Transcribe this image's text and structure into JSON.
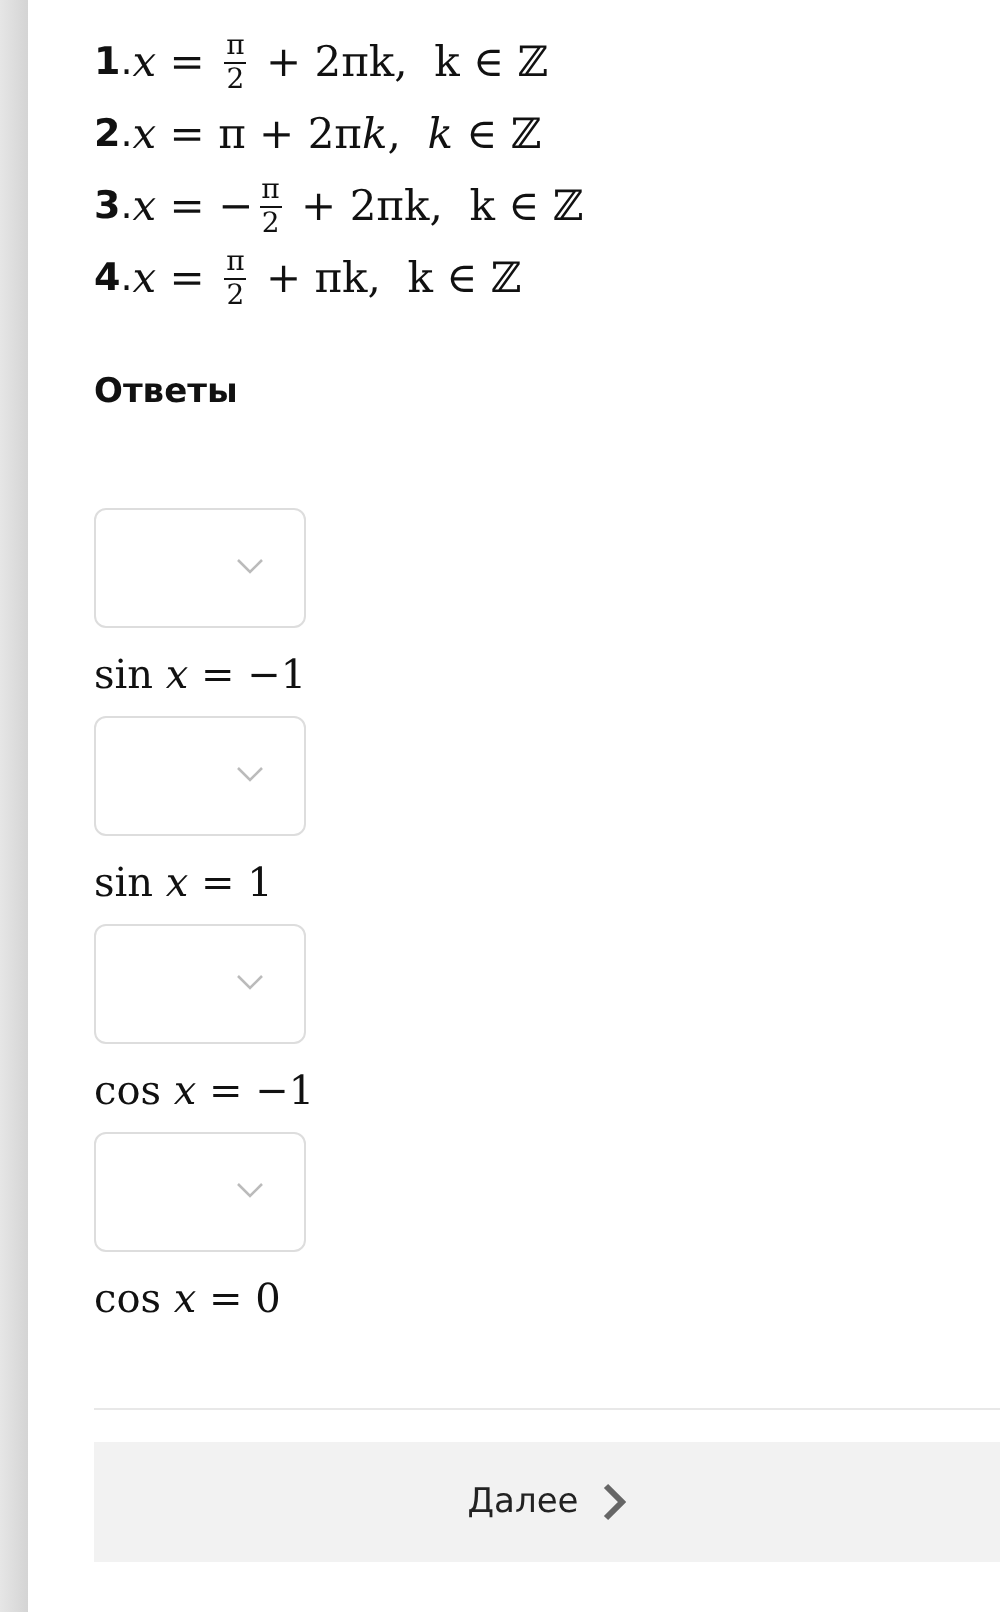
{
  "options": [
    {
      "number": "**1**.",
      "formula": [
        {
          "kind": "it",
          "text": "x"
        },
        {
          "kind": "text",
          "text": " = "
        },
        {
          "kind": "frac",
          "num": "π",
          "den": "2"
        },
        {
          "kind": "text",
          "text": " + 2πk,  k ∈ ℤ"
        }
      ]
    },
    {
      "number": "**2**.",
      "formula": [
        {
          "kind": "it",
          "text": "x"
        },
        {
          "kind": "text",
          "text": " = π + 2π"
        },
        {
          "kind": "it",
          "text": "k"
        },
        {
          "kind": "text",
          "text": ",  "
        },
        {
          "kind": "it",
          "text": "k"
        },
        {
          "kind": "text",
          "text": " ∈ ℤ"
        }
      ]
    },
    {
      "number": "**3**.",
      "formula": [
        {
          "kind": "it",
          "text": "x"
        },
        {
          "kind": "text",
          "text": " = −"
        },
        {
          "kind": "frac",
          "num": "π",
          "den": "2"
        },
        {
          "kind": "text",
          "text": " + 2πk,  k ∈ ℤ"
        }
      ]
    },
    {
      "number": "**4**.",
      "formula": [
        {
          "kind": "it",
          "text": "x"
        },
        {
          "kind": "text",
          "text": " = "
        },
        {
          "kind": "frac",
          "num": "π",
          "den": "2"
        },
        {
          "kind": "text",
          "text": " + πk,  k ∈ ℤ"
        }
      ]
    }
  ],
  "answers_heading": "Ответы",
  "answers": [
    {
      "label": "sin *x* = −1"
    },
    {
      "label": "sin *x* = 1"
    },
    {
      "label": "cos *x* = −1"
    },
    {
      "label": "cos *x* = 0"
    }
  ],
  "next_button": {
    "label": "Далее"
  }
}
